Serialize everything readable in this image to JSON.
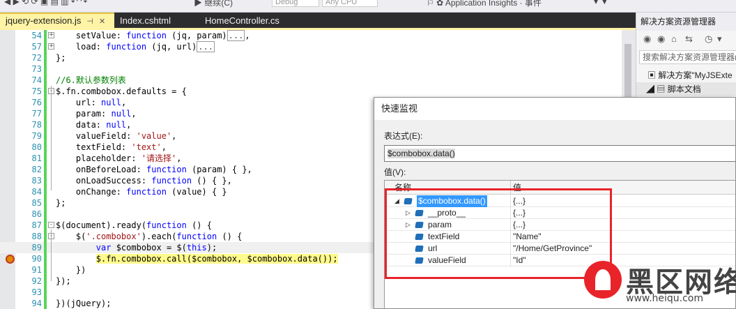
{
  "toolbar": {
    "config_dropdown": "Debug",
    "platform_dropdown": "Any CPU",
    "run_label": "继续(C)",
    "insights_label": "Application Insights · 事件"
  },
  "tabs": [
    {
      "label": "jquery-extension.js",
      "active": true,
      "pin": "⊣",
      "close": "✕"
    },
    {
      "label": "Index.cshtml",
      "active": false
    },
    {
      "label": "HomeController.cs",
      "active": false
    }
  ],
  "editor": {
    "lines": [
      {
        "n": "54",
        "html": "    setValue: <span class=\"kw\">function</span> (jq, param)<span class=\"coll\">...</span>,",
        "fold": "+"
      },
      {
        "n": "57",
        "html": "    load: <span class=\"kw\">function</span> (jq, url)<span class=\"coll\">...</span>",
        "fold": "+"
      },
      {
        "n": "72",
        "html": "};"
      },
      {
        "n": "73",
        "html": ""
      },
      {
        "n": "74",
        "html": "<span class=\"cm\">//6.默认参数列表</span>"
      },
      {
        "n": "75",
        "html": "$.fn.combobox.defaults = {",
        "fold": "-"
      },
      {
        "n": "76",
        "html": "    url: <span class=\"kw\">null</span>,"
      },
      {
        "n": "77",
        "html": "    param: <span class=\"kw\">null</span>,"
      },
      {
        "n": "78",
        "html": "    data: <span class=\"kw\">null</span>,"
      },
      {
        "n": "79",
        "html": "    valueField: <span class=\"str\">'value'</span>,"
      },
      {
        "n": "80",
        "html": "    textField: <span class=\"str\">'text'</span>,"
      },
      {
        "n": "81",
        "html": "    placeholder: <span class=\"str\">'请选择'</span>,"
      },
      {
        "n": "82",
        "html": "    onBeforeLoad: <span class=\"kw\">function</span> (param) { },"
      },
      {
        "n": "83",
        "html": "    onLoadSuccess: <span class=\"kw\">function</span> () { },"
      },
      {
        "n": "84",
        "html": "    onChange: <span class=\"kw\">function</span> (value) { }"
      },
      {
        "n": "85",
        "html": "};"
      },
      {
        "n": "86",
        "html": ""
      },
      {
        "n": "87",
        "html": "$(document).ready(<span class=\"kw\">function</span> () {",
        "fold": "-"
      },
      {
        "n": "88",
        "html": "    $(<span class=\"str\">'.combobox'</span>).each(<span class=\"kw\">function</span> () {",
        "fold": "-"
      },
      {
        "n": "89",
        "html": "        <span class=\"kw\">var</span> $combobox = $(<span class=\"kw\">this</span>);",
        "current": true
      },
      {
        "n": "90",
        "html": "        <span class=\"hl-yellow\">$.fn.combobox.call($combobox, $combobox.data());</span>",
        "breakpoint": true
      },
      {
        "n": "91",
        "html": "    })"
      },
      {
        "n": "92",
        "html": "});"
      },
      {
        "n": "93",
        "html": ""
      },
      {
        "n": "94",
        "html": "})(jQuery);"
      }
    ]
  },
  "solution_explorer": {
    "title": "解决方案资源管理器",
    "search_placeholder": "搜索解决方案资源管理器(",
    "solution_label": "解决方案\"MyJSExte",
    "folder_label": "脚本文档"
  },
  "quickwatch": {
    "title": "快速监视",
    "expression_label": "表达式(E):",
    "expression_value": "$combobox.data()",
    "value_label": "值(V):",
    "col_name": "名称",
    "col_value": "值",
    "rows": [
      {
        "name": "$combobox.data()",
        "value": "{...}",
        "depth": 0,
        "expander": "◢",
        "selected": true
      },
      {
        "name": "__proto__",
        "value": "{...}",
        "depth": 1,
        "expander": "▷"
      },
      {
        "name": "param",
        "value": "{...}",
        "depth": 1,
        "expander": "▷"
      },
      {
        "name": "textField",
        "value": "\"Name\"",
        "depth": 1,
        "expander": ""
      },
      {
        "name": "url",
        "value": "\"/Home/GetProvince\"",
        "depth": 1,
        "expander": ""
      },
      {
        "name": "valueField",
        "value": "\"Id\"",
        "depth": 1,
        "expander": ""
      }
    ]
  },
  "watermark": {
    "text": "黑区网络",
    "url": "www.heiqu.com"
  }
}
